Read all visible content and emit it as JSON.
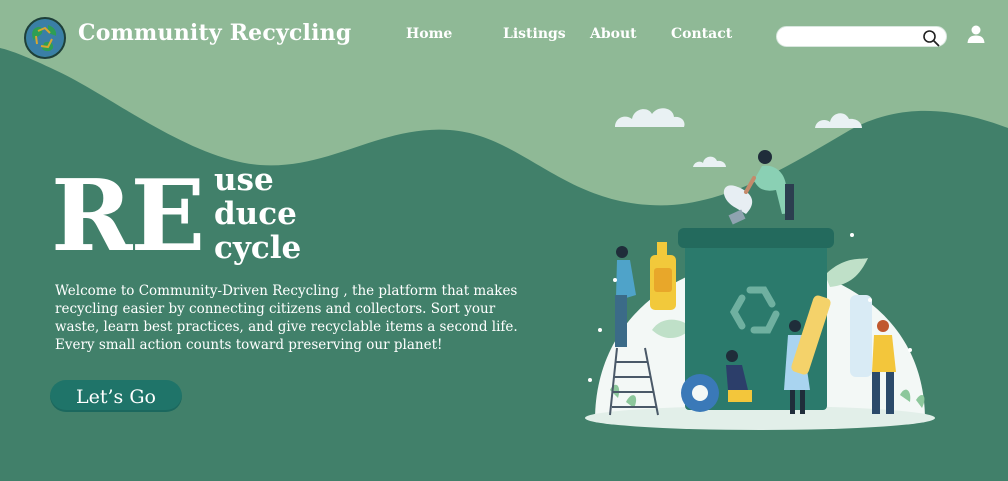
{
  "header": {
    "brand": "Community Recycling",
    "nav": [
      "Home",
      "Listings",
      "About",
      "Contact"
    ],
    "search": {
      "placeholder": "",
      "value": ""
    }
  },
  "hero": {
    "prefix": "RE",
    "words": [
      "use",
      "duce",
      "cycle"
    ],
    "description": "Welcome to Community-Driven Recycling , the platform that makes recycling easier by connecting citizens and collectors. Sort your waste, learn best practices, and give recyclable items a second life. Every small action counts toward preserving our planet!",
    "cta_label": "Let’s Go"
  },
  "colors": {
    "background": "#41806a",
    "light_hill": "#8fb996",
    "button": "#1f7469",
    "bin": "#2b7a6c",
    "text": "#ffffff"
  },
  "icons": {
    "logo": "globe-recycle-logo",
    "search": "search-icon",
    "user": "user-icon",
    "recycle": "recycle-icon"
  }
}
